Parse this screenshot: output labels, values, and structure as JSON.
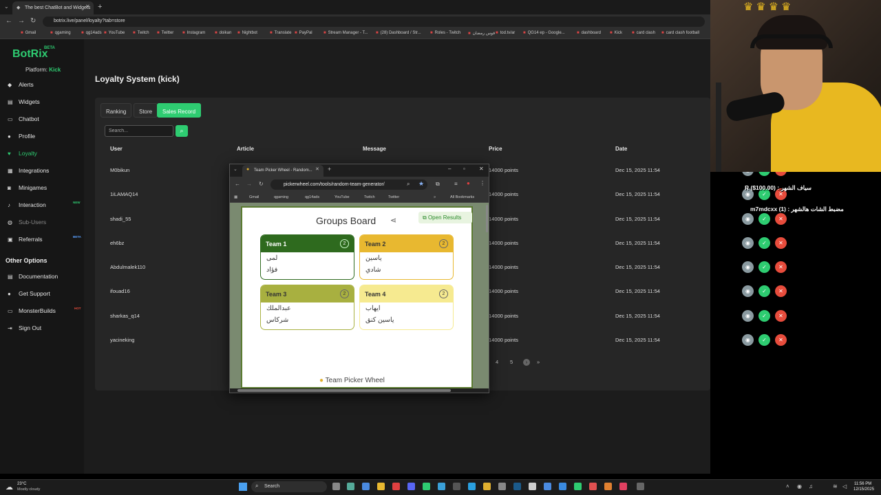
{
  "browser": {
    "tab_title": "The best ChatBot and Widgets",
    "url": "botrix.live/panel/loyalty?tab=store",
    "bookmarks": [
      "Gmail",
      "qgaming",
      "qg14ads",
      "YouTube",
      "Twitch",
      "Twitter",
      "Instagram",
      "doikan",
      "Nightbot",
      "Translate",
      "PayPal",
      "Stream Manager - T...",
      "(28) Dashboard / Str...",
      "Roles - Twitch",
      "قوس رمضان",
      "tod.tv/ar",
      "QG14 ep - Google...",
      "dashboard",
      "Kick",
      "card clash",
      "card clash football"
    ]
  },
  "sidebar": {
    "logo": "BotRix",
    "logo_badge": "BETA",
    "platform_label": "Platform:",
    "platform_value": "Kick",
    "items": [
      {
        "label": "Alerts",
        "icon": "bell-icon"
      },
      {
        "label": "Widgets",
        "icon": "widgets-icon"
      },
      {
        "label": "Chatbot",
        "icon": "chat-icon"
      },
      {
        "label": "Profile",
        "icon": "user-icon"
      },
      {
        "label": "Loyalty",
        "icon": "heart-icon"
      },
      {
        "label": "Integrations",
        "icon": "integrations-icon"
      },
      {
        "label": "Minigames",
        "icon": "gamepad-icon"
      },
      {
        "label": "Interaction",
        "icon": "music-icon",
        "badge": "NEW"
      },
      {
        "label": "Sub-Users",
        "icon": "users-icon"
      },
      {
        "label": "Referrals",
        "icon": "referrals-icon",
        "badge": "BETA"
      }
    ],
    "other_heading": "Other Options",
    "other_items": [
      {
        "label": "Documentation",
        "icon": "doc-icon"
      },
      {
        "label": "Get Support",
        "icon": "support-icon"
      },
      {
        "label": "MonsterBuilds",
        "icon": "monitor-icon",
        "badge": "HOT"
      },
      {
        "label": "Sign Out",
        "icon": "signout-icon"
      }
    ]
  },
  "main": {
    "title": "Loyalty System (kick)",
    "tabs": [
      "Ranking",
      "Store",
      "Sales Record"
    ],
    "search_placeholder": "Search...",
    "columns": [
      "User",
      "Article",
      "Message",
      "Price",
      "Date"
    ],
    "rows": [
      {
        "user": "M0bikun",
        "price": "14000 points",
        "date": "Dec 15, 2025 11:54"
      },
      {
        "user": "1iLAMAQ14",
        "price": "14000 points",
        "date": "Dec 15, 2025 11:54"
      },
      {
        "user": "shadi_55",
        "price": "14000 points",
        "date": "Dec 15, 2025 11:54"
      },
      {
        "user": "eh6bz",
        "price": "14000 points",
        "date": "Dec 15, 2025 11:54"
      },
      {
        "user": "Abdulmalek110",
        "price": "14000 points",
        "date": "Dec 15, 2025 11:54"
      },
      {
        "user": "ifouad16",
        "price": "14000 points",
        "date": "Dec 15, 2025 11:54"
      },
      {
        "user": "sharkas_q14",
        "price": "14000 points",
        "date": "Dec 15, 2025 11:54"
      },
      {
        "user": "yacineking",
        "price": "14000 points",
        "date": "Dec 15, 2025 11:54"
      }
    ],
    "pagination": [
      "4",
      "5",
      "›",
      "»"
    ]
  },
  "popup": {
    "tab_title": "Team Picker Wheel - Random...",
    "url": "pickerwheel.com/tools/random-team-generator/",
    "bookmarks": [
      "Gmail",
      "qgaming",
      "qg14ads",
      "YouTube",
      "Twitch",
      "Twitter",
      "All Bookmarks"
    ],
    "board_title": "Groups Board",
    "open_results": "Open Results",
    "footer": "Team Picker Wheel",
    "teams": [
      {
        "name": "Team 1",
        "count": "2",
        "members": [
          "لمى",
          "فؤاد"
        ]
      },
      {
        "name": "Team 2",
        "count": "2",
        "members": [
          "ياسين",
          "شادي"
        ]
      },
      {
        "name": "Team 3",
        "count": "2",
        "members": [
          "عبدالملك",
          "شركاس"
        ]
      },
      {
        "name": "Team 4",
        "count": "2",
        "members": [
          "ايهاب",
          "ياسين كنق"
        ]
      }
    ]
  },
  "overlay": {
    "lines": [
      "سياف الشهر : R ($100.00)",
      "مضبط الشات هالشهر : m7mdcxx (1)"
    ]
  },
  "taskbar": {
    "weather_temp": "23°C",
    "weather_desc": "Mostly cloudy",
    "search_label": "Search",
    "time": "11:56 PM",
    "date": "12/15/2025"
  }
}
